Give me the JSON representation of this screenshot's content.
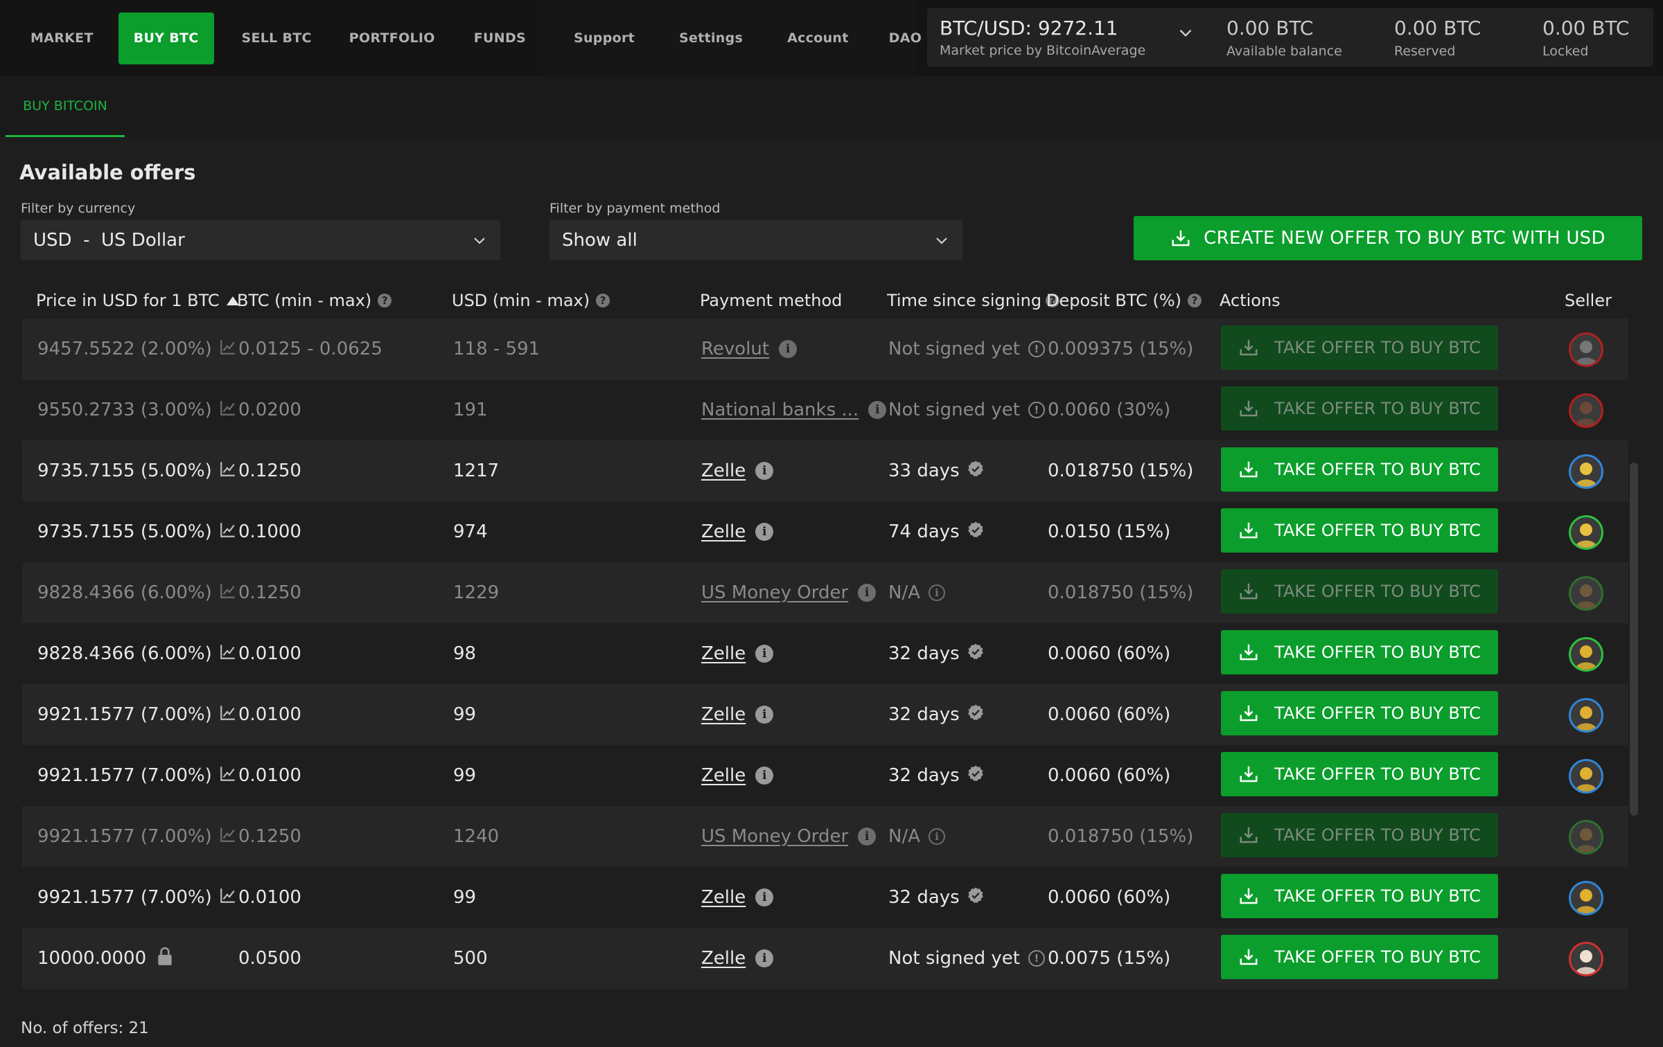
{
  "nav": {
    "main": [
      "MARKET",
      "BUY BTC",
      "SELL BTC",
      "PORTFOLIO",
      "FUNDS"
    ],
    "active": "BUY BTC",
    "secondary": [
      "Support",
      "Settings",
      "Account",
      "DAO"
    ]
  },
  "price": {
    "pair": "BTC/USD: 9272.11",
    "source": "Market price by BitcoinAverage"
  },
  "balances": [
    {
      "value": "0.00 BTC",
      "label": "Available balance"
    },
    {
      "value": "0.00 BTC",
      "label": "Reserved"
    },
    {
      "value": "0.00 BTC",
      "label": "Locked"
    }
  ],
  "subtab": "BUY BITCOIN",
  "offers": {
    "title": "Available offers",
    "currency_filter_label": "Filter by currency",
    "currency_filter_value": "USD  -  US Dollar",
    "payment_filter_label": "Filter by payment method",
    "payment_filter_value": "Show all",
    "create_button": "CREATE NEW OFFER TO BUY BTC WITH USD",
    "count_text": "No. of offers: 21"
  },
  "columns": [
    "Price in USD for 1 BTC",
    "BTC (min - max)",
    "USD (min - max)",
    "Payment method",
    "Time since signing",
    "Deposit BTC (%)",
    "Actions",
    "Seller"
  ],
  "take_label": "TAKE OFFER TO BUY BTC",
  "colors": {
    "accent": "#0b9e2c",
    "accent_dim": "#104a1d",
    "bg": "#1e1e1e",
    "row_alt": "#262626"
  },
  "rows": [
    {
      "price": "9457.5522 (2.00%)",
      "btc": "0.0125 - 0.0625",
      "usd": "118 - 591",
      "payment": "Revolut",
      "time": "Not signed yet",
      "deposit": "0.009375 (15%)",
      "dim": true,
      "status": "warn",
      "price_icon": "chart-icon",
      "avatar_border": "#b02020",
      "avatar_color": "#777777"
    },
    {
      "price": "9550.2733 (3.00%)",
      "btc": "0.0200",
      "usd": "191",
      "payment": "National banks ...",
      "time": "Not signed yet",
      "deposit": "0.0060 (30%)",
      "dim": true,
      "status": "warn",
      "price_icon": "chart-icon",
      "avatar_border": "#b02020",
      "avatar_color": "#6b4a3a"
    },
    {
      "price": "9735.7155 (5.00%)",
      "btc": "0.1250",
      "usd": "1217",
      "payment": "Zelle",
      "time": "33 days",
      "deposit": "0.018750 (15%)",
      "dim": false,
      "status": "check",
      "price_icon": "chart-icon",
      "avatar_border": "#2f86d6",
      "avatar_color": "#e8c040"
    },
    {
      "price": "9735.7155 (5.00%)",
      "btc": "0.1000",
      "usd": "974",
      "payment": "Zelle",
      "time": "74 days",
      "deposit": "0.0150 (15%)",
      "dim": false,
      "status": "check",
      "price_icon": "chart-icon",
      "avatar_border": "#2fbf3f",
      "avatar_color": "#e8c040"
    },
    {
      "price": "9828.4366 (6.00%)",
      "btc": "0.1250",
      "usd": "1229",
      "payment": "US Money Order",
      "time": "N/A",
      "deposit": "0.018750 (15%)",
      "dim": true,
      "status": "na",
      "price_icon": "chart-icon",
      "avatar_border": "#2f6f2f",
      "avatar_color": "#6e5a3a"
    },
    {
      "price": "9828.4366 (6.00%)",
      "btc": "0.0100",
      "usd": "98",
      "payment": "Zelle",
      "time": "32 days",
      "deposit": "0.0060 (60%)",
      "dim": false,
      "status": "check",
      "price_icon": "chart-icon",
      "avatar_border": "#2fbf3f",
      "avatar_color": "#e0b030"
    },
    {
      "price": "9921.1577 (7.00%)",
      "btc": "0.0100",
      "usd": "99",
      "payment": "Zelle",
      "time": "32 days",
      "deposit": "0.0060 (60%)",
      "dim": false,
      "status": "check",
      "price_icon": "chart-icon",
      "avatar_border": "#2f86d6",
      "avatar_color": "#e0b030"
    },
    {
      "price": "9921.1577 (7.00%)",
      "btc": "0.0100",
      "usd": "99",
      "payment": "Zelle",
      "time": "32 days",
      "deposit": "0.0060 (60%)",
      "dim": false,
      "status": "check",
      "price_icon": "chart-icon",
      "avatar_border": "#2f86d6",
      "avatar_color": "#e0b030"
    },
    {
      "price": "9921.1577 (7.00%)",
      "btc": "0.1250",
      "usd": "1240",
      "payment": "US Money Order",
      "time": "N/A",
      "deposit": "0.018750 (15%)",
      "dim": true,
      "status": "na",
      "price_icon": "chart-icon",
      "avatar_border": "#2f6f2f",
      "avatar_color": "#6e5a3a"
    },
    {
      "price": "9921.1577 (7.00%)",
      "btc": "0.0100",
      "usd": "99",
      "payment": "Zelle",
      "time": "32 days",
      "deposit": "0.0060 (60%)",
      "dim": false,
      "status": "check",
      "price_icon": "chart-icon",
      "avatar_border": "#2f86d6",
      "avatar_color": "#e0b030"
    },
    {
      "price": "10000.0000",
      "btc": "0.0500",
      "usd": "500",
      "payment": "Zelle",
      "time": "Not signed yet",
      "deposit": "0.0075 (15%)",
      "dim": false,
      "status": "warn",
      "price_icon": "lock-icon",
      "avatar_border": "#d03030",
      "avatar_color": "#f0e0d0"
    }
  ]
}
